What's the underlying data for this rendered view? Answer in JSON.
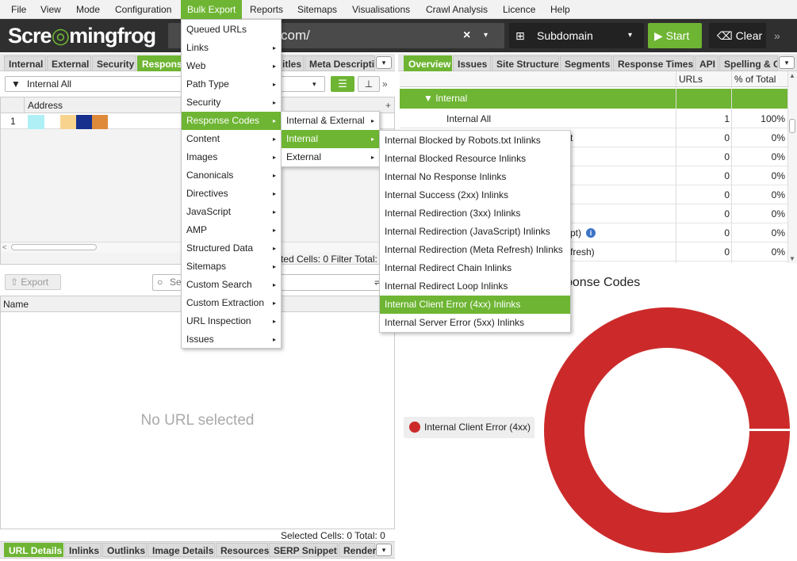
{
  "menubar": [
    "File",
    "View",
    "Mode",
    "Configuration",
    "Bulk Export",
    "Reports",
    "Sitemaps",
    "Visualisations",
    "Crawl Analysis",
    "Licence",
    "Help"
  ],
  "toolbar": {
    "logo_text_left": "Scre",
    "logo_text_right": "mingfrog",
    "url_text": "com/",
    "url_clear": "×",
    "url_dd": "▾",
    "mode_icon": "⊞",
    "mode_label": "Subdomain",
    "mode_dd": "▾",
    "start_label": "▶ Start",
    "clear_label": "⌫ Clear",
    "more": "»"
  },
  "left_tabs": [
    "Internal",
    "External",
    "Security",
    "Respons",
    "itles",
    "Meta Descripti"
  ],
  "left_tab_dd": "▾",
  "filter": {
    "icon": "▼",
    "label": "Internal All",
    "dd": "▾"
  },
  "view": {
    "list": "☰",
    "tree": "⊥",
    "more": "»"
  },
  "grid": {
    "address_header": "Address",
    "plus": "+",
    "row1_num": "1",
    "scroll_left": "<",
    "status": "ted Cells:  0  Filter Total:"
  },
  "lower": {
    "export_label": "⇧ Export",
    "search_icon": "○",
    "search_placeholder": "Se",
    "search_opt": "⇌",
    "name_header": "Name",
    "empty_text": "No URL selected",
    "status": "Selected Cells:  0  Total:  0"
  },
  "bottom_tabs": [
    "URL Details",
    "Inlinks",
    "Outlinks",
    "Image Details",
    "Resources",
    "SERP Snippet",
    "Render"
  ],
  "bottom_tab_dd": "▾",
  "right_tabs": [
    "Overview",
    "Issues",
    "Site Structure",
    "Segments",
    "Response Times",
    "API",
    "Spelling & G"
  ],
  "right_tab_dd": "▾",
  "overview": {
    "col_urls": "URLs",
    "col_pct": "% of Total",
    "group": "▼    Internal",
    "rows": [
      {
        "label": "Internal All",
        "urls": "1",
        "pct": "100%"
      },
      {
        "label": "t",
        "urls": "0",
        "pct": "0%"
      },
      {
        "label": "",
        "urls": "0",
        "pct": "0%"
      },
      {
        "label": "",
        "urls": "0",
        "pct": "0%"
      },
      {
        "label": "",
        "urls": "0",
        "pct": "0%"
      },
      {
        "label": "pt)",
        "urls": "0",
        "pct": "0%"
      },
      {
        "label": "fresh)",
        "urls": "0",
        "pct": "0%"
      }
    ],
    "info_icon": "i",
    "scroll_up": "▲",
    "scroll_down": "▼"
  },
  "chart": {
    "title": "sponse Codes",
    "legend_label": "Internal Client Error (4xx)",
    "color": "#cc2a2a"
  },
  "chart_data": {
    "type": "pie",
    "categories": [
      "Internal Client Error (4xx)"
    ],
    "values": [
      100
    ],
    "title": "Response Codes",
    "legend": "left"
  },
  "bulk_export_menu": [
    "Queued URLs",
    "Links",
    "Web",
    "Path Type",
    "Security",
    "Response Codes",
    "Content",
    "Images",
    "Canonicals",
    "Directives",
    "JavaScript",
    "AMP",
    "Structured Data",
    "Sitemaps",
    "Custom Search",
    "Custom Extraction",
    "URL Inspection",
    "Issues"
  ],
  "bulk_export_submenu_flags": [
    false,
    true,
    true,
    true,
    true,
    true,
    true,
    true,
    true,
    true,
    true,
    true,
    true,
    true,
    true,
    true,
    true,
    true
  ],
  "response_codes_menu": [
    "Internal & External",
    "Internal",
    "External"
  ],
  "internal_menu": [
    "Internal Blocked by Robots.txt Inlinks",
    "Internal Blocked Resource Inlinks",
    "Internal No Response Inlinks",
    "Internal Success (2xx) Inlinks",
    "Internal Redirection (3xx) Inlinks",
    "Internal Redirection (JavaScript) Inlinks",
    "Internal Redirection (Meta Refresh) Inlinks",
    "Internal Redirect Chain Inlinks",
    "Internal Redirect Loop Inlinks",
    "Internal Client Error (4xx) Inlinks",
    "Internal Server Error (5xx) Inlinks"
  ],
  "menu_arrow": "▸"
}
